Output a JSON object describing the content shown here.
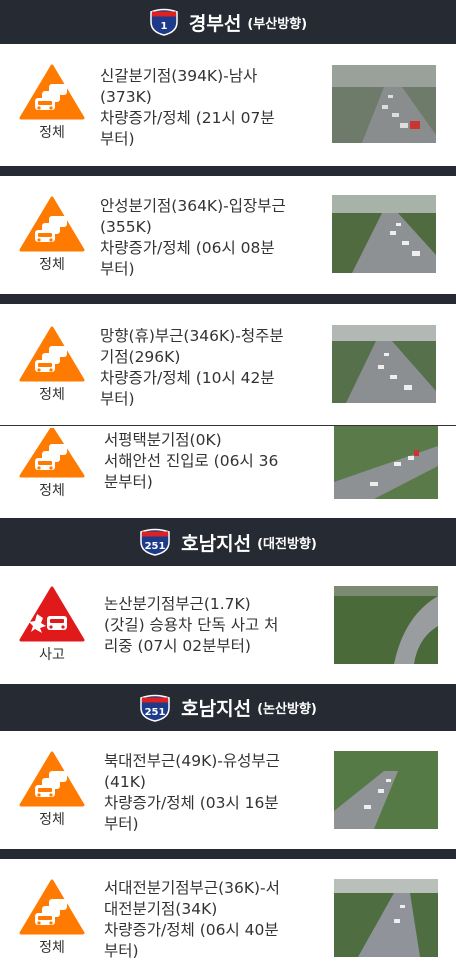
{
  "sections": [
    {
      "route": "1",
      "route_color": "#1e3a8a",
      "title": "경부선",
      "direction": "(부산방향)"
    },
    {
      "route": "251",
      "route_color": "#1e3a8a",
      "title": "호남지선",
      "direction": "(대전방향)"
    },
    {
      "route": "251",
      "route_color": "#1e3a8a",
      "title": "호남지선",
      "direction": "(논산방향)"
    }
  ],
  "items": [
    {
      "status": "정체",
      "type": "congestion",
      "line1": "신갈분기점(394K)-남사",
      "line2": "(373K)",
      "line3": "차량증가/정체 (21시 07분",
      "line4": "부터)"
    },
    {
      "status": "정체",
      "type": "congestion",
      "line1": "안성분기점(364K)-입장부근",
      "line2": "(355K)",
      "line3": "차량증가/정체 (06시 08분",
      "line4": "부터)"
    },
    {
      "status": "정체",
      "type": "congestion",
      "line1": "망향(휴)부근(346K)-청주분",
      "line2": "기점(296K)",
      "line3": "차량증가/정체 (10시 42분",
      "line4": "부터)"
    },
    {
      "status": "정체",
      "type": "congestion",
      "line1": "서평택분기점(0K)",
      "line2": "서해안선 진입로 (06시 36",
      "line3": "분부터)",
      "line4": ""
    },
    {
      "status": "사고",
      "type": "accident",
      "line1": "논산분기점부근(1.7K)",
      "line2": "(갓길) 승용차 단독 사고 처",
      "line3": "리중 (07시 02분부터)",
      "line4": ""
    },
    {
      "status": "정체",
      "type": "congestion",
      "line1": "북대전부근(49K)-유성부근",
      "line2": "(41K)",
      "line3": "차량증가/정체 (03시 16분",
      "line4": "부터)"
    },
    {
      "status": "정체",
      "type": "congestion",
      "line1": "서대전분기점부근(36K)-서",
      "line2": "대전분기점(34K)",
      "line3": "차량증가/정체 (06시 40분",
      "line4": "부터)"
    }
  ],
  "colors": {
    "congestion": "#ff7a00",
    "accident": "#e0191b",
    "header_bg": "#262a33"
  }
}
